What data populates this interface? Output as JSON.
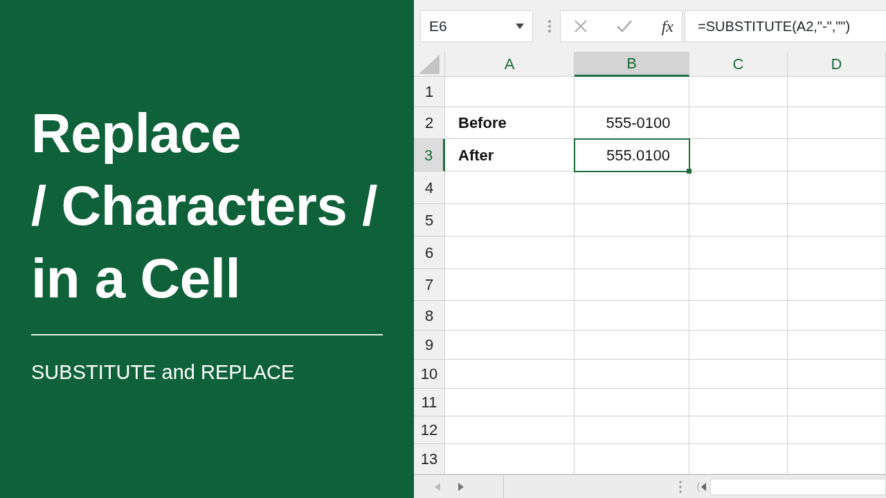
{
  "banner": {
    "title_lines": [
      "Replace",
      "/ Characters /",
      "in a Cell"
    ],
    "subtitle": "SUBSTITUTE and REPLACE"
  },
  "formula_bar": {
    "name_box": "E6",
    "function_label": "fx",
    "formula": "=SUBSTITUTE(A2,\"-\",\"\")"
  },
  "columns": [
    {
      "label": "A",
      "selected": false
    },
    {
      "label": "B",
      "selected": true
    },
    {
      "label": "C",
      "selected": false
    },
    {
      "label": "D",
      "selected": false
    }
  ],
  "rows": [
    {
      "label": "1",
      "selected": false
    },
    {
      "label": "2",
      "selected": false,
      "cells": [
        {
          "text": "Before",
          "bold": true,
          "active": false
        },
        {
          "text": "555-0100",
          "bold": false,
          "active": false
        }
      ]
    },
    {
      "label": "3",
      "selected": true,
      "cells": [
        {
          "text": "After",
          "bold": true,
          "active": false
        },
        {
          "text": "555.0100",
          "bold": false,
          "active": true
        }
      ]
    },
    {
      "label": "4",
      "selected": false
    },
    {
      "label": "5",
      "selected": false
    },
    {
      "label": "6",
      "selected": false
    },
    {
      "label": "7",
      "selected": false
    },
    {
      "label": "8",
      "selected": false
    },
    {
      "label": "9",
      "selected": false
    },
    {
      "label": "10",
      "selected": false
    },
    {
      "label": "11",
      "selected": false
    },
    {
      "label": "12",
      "selected": false
    },
    {
      "label": "13",
      "selected": false
    }
  ]
}
